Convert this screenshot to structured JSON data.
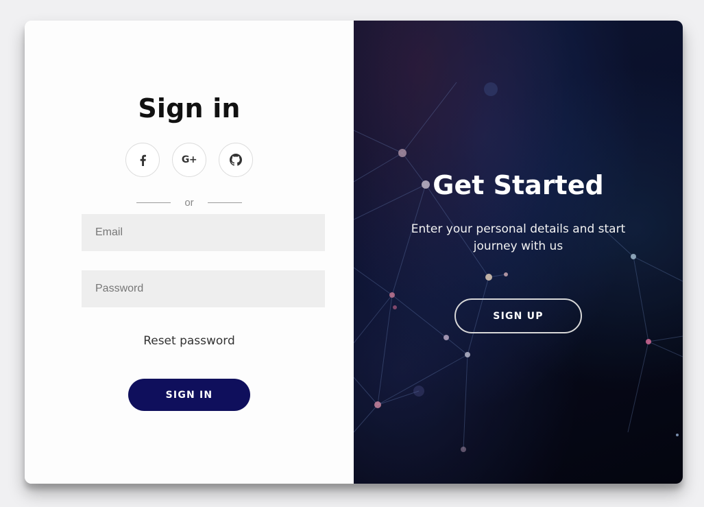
{
  "signin": {
    "title": "Sign in",
    "socials": [
      {
        "name": "facebook",
        "icon": "facebook-icon"
      },
      {
        "name": "google-plus",
        "icon": "google-plus-icon",
        "glyph": "G+"
      },
      {
        "name": "github",
        "icon": "github-icon"
      }
    ],
    "divider_text": "or",
    "email_placeholder": "Email",
    "password_placeholder": "Password",
    "reset_link": "Reset password",
    "button_label": "SIGN IN"
  },
  "signup_panel": {
    "title": "Get Started",
    "subtitle": "Enter your personal details and start journey with us",
    "button_label": "SIGN UP"
  },
  "colors": {
    "primary_button": "#0f0f5c",
    "input_background": "#eeeeee",
    "panel_dark": "#0b1230",
    "page_background": "#f0f0f2"
  }
}
